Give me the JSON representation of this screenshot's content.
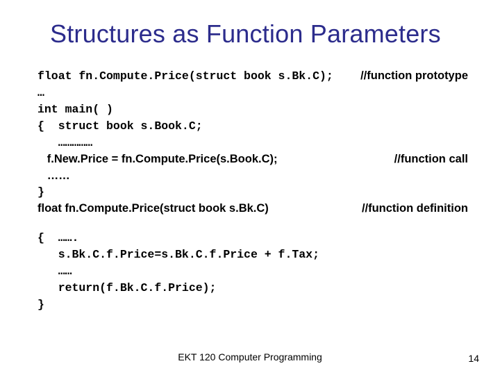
{
  "title": "Structures as Function Parameters",
  "code": {
    "l1_left": "float fn.Compute.Price(struct book s.Bk.C); ",
    "l1_right": "//function prototype",
    "l2": "…",
    "l3": "int main( )",
    "l4": "{  struct book s.Book.C;",
    "l5": "   ……………",
    "l6_left": "   f.New.Price = fn.Compute.Price(s.Book.C);",
    "l6_right": "//function call",
    "l7": "   ……",
    "l8": "}",
    "l9_left": "float fn.Compute.Price(struct book s.Bk.C)",
    "l9_right": "//function definition",
    "b1": "{  …….",
    "b2": "   s.Bk.C.f.Price=s.Bk.C.f.Price + f.Tax;",
    "b3": "   ……",
    "b4": "   return(f.Bk.C.f.Price);",
    "b5": "}"
  },
  "footer": "EKT 120 Computer Programming",
  "pagenum": "14"
}
